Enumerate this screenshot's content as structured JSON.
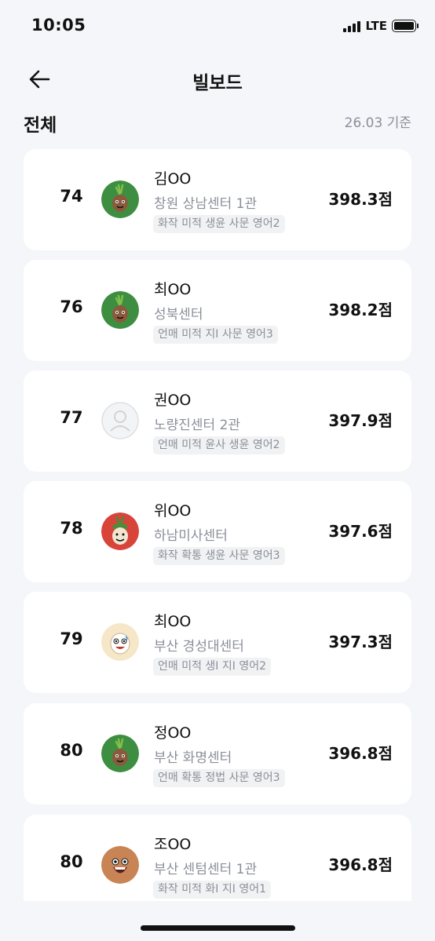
{
  "status_bar": {
    "time": "10:05",
    "network": "LTE"
  },
  "header": {
    "title": "빌보드"
  },
  "section": {
    "title": "전체",
    "as_of": "26.03 기준"
  },
  "entries": [
    {
      "rank": "74",
      "name": "김OO",
      "center": "창원 상남센터 1관",
      "subjects": "화작 미적 생윤 사문 영어2",
      "score": "398.3점",
      "avatar": "green-onion-character"
    },
    {
      "rank": "76",
      "name": "최OO",
      "center": "성북센터",
      "subjects": "언매 미적 지I 사문 영어3",
      "score": "398.2점",
      "avatar": "green-onion-character"
    },
    {
      "rank": "77",
      "name": "권OO",
      "center": "노량진센터 2관",
      "subjects": "언매 미적 윤사 생윤 영어2",
      "score": "397.9점",
      "avatar": "default-profile"
    },
    {
      "rank": "78",
      "name": "위OO",
      "center": "하남미사센터",
      "subjects": "화작 확통 생윤 사문 영어3",
      "score": "397.6점",
      "avatar": "red-onion-character"
    },
    {
      "rank": "79",
      "name": "최OO",
      "center": "부산 경성대센터",
      "subjects": "언매 미적 생I 지I 영어2",
      "score": "397.3점",
      "avatar": "cream-egg-character"
    },
    {
      "rank": "80",
      "name": "정OO",
      "center": "부산 화명센터",
      "subjects": "언매 확통 정법 사문 영어3",
      "score": "396.8점",
      "avatar": "green-onion-character"
    },
    {
      "rank": "80",
      "name": "조OO",
      "center": "부산 센텀센터 1관",
      "subjects": "화작 미적 화I 지I 영어1",
      "score": "396.8점",
      "avatar": "brown-potato-character"
    }
  ]
}
